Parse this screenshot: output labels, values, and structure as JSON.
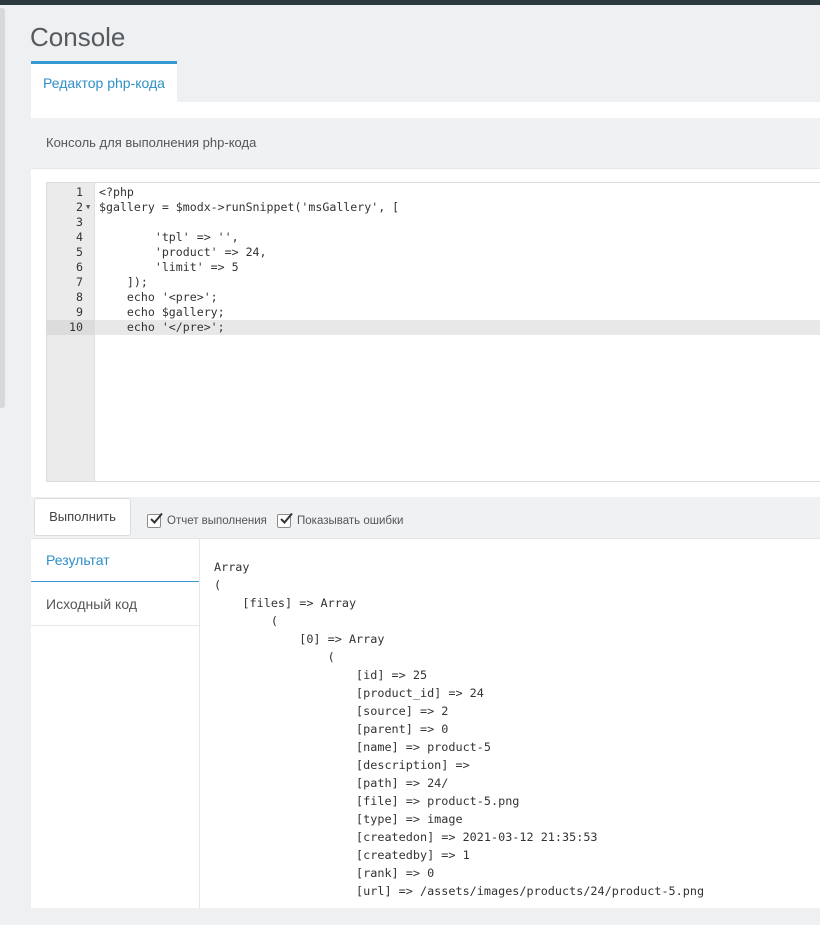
{
  "page": {
    "title": "Console"
  },
  "tabs": {
    "editor_tab": "Редактор php-кода"
  },
  "panel": {
    "description": "Консоль для выполнения php-кода"
  },
  "editor": {
    "lines": [
      {
        "n": "1",
        "text": "<?php"
      },
      {
        "n": "2",
        "text": "$gallery = $modx->runSnippet('msGallery', [",
        "fold": true
      },
      {
        "n": "3",
        "text": ""
      },
      {
        "n": "4",
        "text": "        'tpl' => '',"
      },
      {
        "n": "5",
        "text": "        'product' => 24,"
      },
      {
        "n": "6",
        "text": "        'limit' => 5"
      },
      {
        "n": "7",
        "text": "    ]);"
      },
      {
        "n": "8",
        "text": "    echo '<pre>';"
      },
      {
        "n": "9",
        "text": "    echo $gallery;"
      },
      {
        "n": "10",
        "text": "    echo '</pre>';",
        "active": true
      }
    ]
  },
  "toolbar": {
    "run_label": "Выполнить",
    "report_label": "Отчет выполнения",
    "errors_label": "Показывать ошибки",
    "report_checked": true,
    "errors_checked": true
  },
  "result_tabs": {
    "result": "Результат",
    "source": "Исходный код"
  },
  "output": [
    "Array",
    "(",
    "    [files] => Array",
    "        (",
    "            [0] => Array",
    "                (",
    "                    [id] => 25",
    "                    [product_id] => 24",
    "                    [source] => 2",
    "                    [parent] => 0",
    "                    [name] => product-5",
    "                    [description] => ",
    "                    [path] => 24/",
    "                    [file] => product-5.png",
    "                    [type] => image",
    "                    [createdon] => 2021-03-12 21:35:53",
    "                    [createdby] => 1",
    "                    [rank] => 0",
    "                    [url] => /assets/images/products/24/product-5.png"
  ],
  "colors": {
    "accent": "#3699d2",
    "topbar": "#2c3a40"
  }
}
